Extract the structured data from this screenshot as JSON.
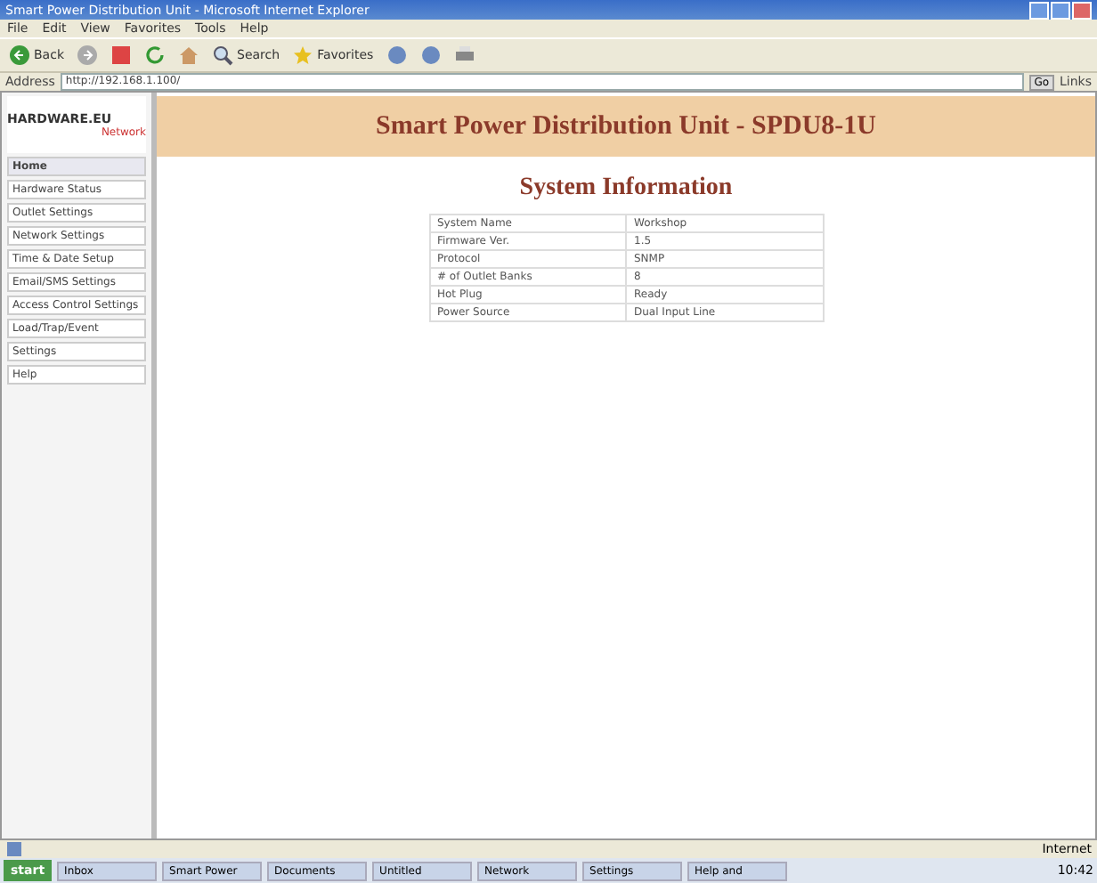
{
  "window": {
    "title": "Smart Power Distribution Unit - Microsoft Internet Explorer"
  },
  "menu": [
    "File",
    "Edit",
    "View",
    "Favorites",
    "Tools",
    "Help"
  ],
  "toolbar": [
    {
      "kind": "back",
      "label": "Back"
    },
    {
      "kind": "forward"
    },
    {
      "kind": "stop"
    },
    {
      "kind": "refresh"
    },
    {
      "kind": "home"
    },
    {
      "kind": "search",
      "label": "Search"
    },
    {
      "kind": "favorites",
      "label": "Favorites"
    },
    {
      "kind": "media"
    },
    {
      "kind": "mail"
    },
    {
      "kind": "print"
    }
  ],
  "address": {
    "label": "Address",
    "value": "http://192.168.1.100/",
    "go": "Go",
    "links": "Links"
  },
  "logo": {
    "name": "HARDWARE.EU",
    "tagline": "Network"
  },
  "sidebar": [
    {
      "label": "Home",
      "selected": true
    },
    {
      "label": "Hardware Status",
      "selected": false
    },
    {
      "label": "Outlet Settings",
      "selected": false
    },
    {
      "label": "Network Settings",
      "selected": false
    },
    {
      "label": "Time & Date Setup",
      "selected": false
    },
    {
      "label": "Email/SMS Settings",
      "selected": false
    },
    {
      "label": "Access Control Settings",
      "selected": false
    },
    {
      "label": "Load/Trap/Event",
      "selected": false
    },
    {
      "label": "Settings",
      "selected": false
    },
    {
      "label": "Help",
      "selected": false
    }
  ],
  "header": "Smart Power Distribution Unit - SPDU8-1U",
  "section_title": "System Information",
  "table": {
    "rows": [
      [
        "System Name",
        "Workshop"
      ],
      [
        "Firmware Ver.",
        "1.5"
      ],
      [
        "Protocol",
        "SNMP"
      ],
      [
        "# of Outlet Banks",
        "8"
      ],
      [
        "Hot Plug",
        "Ready"
      ],
      [
        "Power Source",
        "Dual Input Line"
      ]
    ]
  },
  "status_bar": {
    "zone": "Internet"
  },
  "taskbar": {
    "start": "start",
    "tasks": [
      "Inbox",
      "Smart Power",
      "Documents",
      "Untitled",
      "Network",
      "Settings",
      "Help and"
    ],
    "clock": "10:42"
  }
}
